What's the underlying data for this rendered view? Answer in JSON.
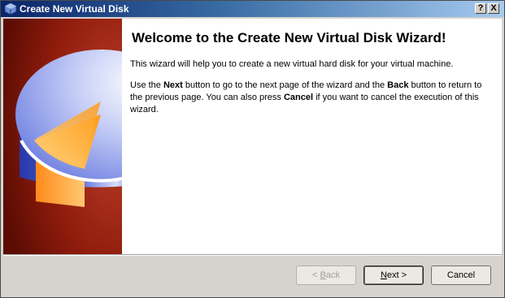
{
  "window": {
    "title": "Create New Virtual Disk",
    "help_label": "?",
    "close_label": "X"
  },
  "main": {
    "heading": "Welcome to the Create New Virtual Disk Wizard!",
    "paragraph1": "This wizard will help you to create a new virtual hard disk for your virtual machine.",
    "paragraph2": {
      "t1": "Use the ",
      "b1": "Next",
      "t2": " button to go to the next page of the wizard and the ",
      "b2": "Back",
      "t3": " button to return to the previous page. You can also press ",
      "b3": "Cancel",
      "t4": " if you want to cancel the execution of this wizard."
    }
  },
  "buttons": {
    "back": {
      "prefix": "< ",
      "mnemonic": "B",
      "rest": "ack",
      "enabled": false
    },
    "next": {
      "mnemonic": "N",
      "rest": "ext >",
      "enabled": true
    },
    "cancel": {
      "label": "Cancel",
      "enabled": true
    }
  },
  "icons": {
    "title": "virtualbox-icon",
    "sidebar": "disk-pie-graphic"
  },
  "colors": {
    "title_gradient_start": "#0a246a",
    "title_gradient_end": "#a6caf0",
    "sidebar_dark_red": "#7a1508",
    "disk_blue": "#5a6fd8",
    "pie_orange": "#ffb347"
  }
}
